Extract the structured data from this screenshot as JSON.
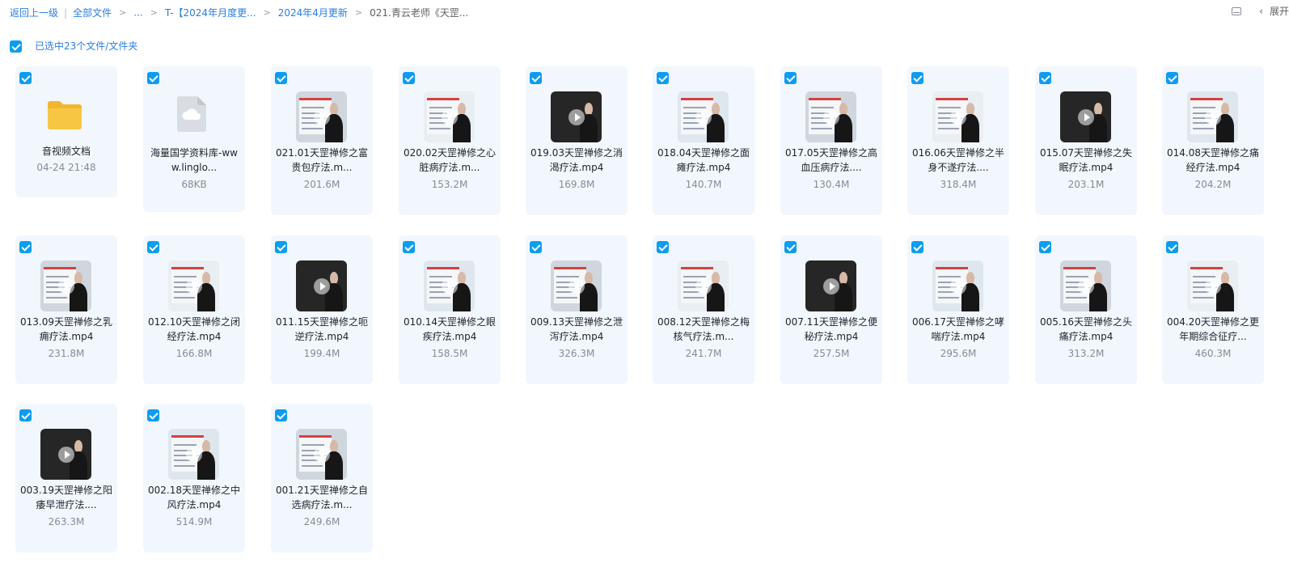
{
  "breadcrumb": {
    "back": "返回上一级",
    "all_files": "全部文件",
    "ellipsis": "...",
    "t_folder": "T-【2024年月度更...",
    "april": "2024年4月更新",
    "current": "021.青云老师《天罡..."
  },
  "toolbar": {
    "expand_label": "展开"
  },
  "selection": {
    "label": "已选中23个文件/文件夹"
  },
  "colors": {
    "accent": "#0d9cf2",
    "link": "#2a7de1",
    "card_bg": "#f1f7fd",
    "folder": "#f7c744"
  },
  "items": [
    {
      "name": "音视频文档",
      "meta": "04-24 21:48",
      "icon": "folder-icon"
    },
    {
      "name": "海量国学资料库-www.linglo...",
      "meta": "68KB",
      "icon": "cloud-file-icon"
    },
    {
      "name": "021.01天罡禅修之富贵包疗法.m...",
      "meta": "201.6M",
      "icon": "video-thumbnail"
    },
    {
      "name": "020.02天罡禅修之心脏病疗法.m...",
      "meta": "153.2M",
      "icon": "video-thumbnail"
    },
    {
      "name": "019.03天罡禅修之消渴疗法.mp4",
      "meta": "169.8M",
      "icon": "video-thumbnail"
    },
    {
      "name": "018.04天罡禅修之面瘫疗法.mp4",
      "meta": "140.7M",
      "icon": "video-thumbnail"
    },
    {
      "name": "017.05天罡禅修之高血压病疗法....",
      "meta": "130.4M",
      "icon": "video-thumbnail"
    },
    {
      "name": "016.06天罡禅修之半身不遂疗法....",
      "meta": "318.4M",
      "icon": "video-thumbnail"
    },
    {
      "name": "015.07天罡禅修之失眠疗法.mp4",
      "meta": "203.1M",
      "icon": "video-thumbnail"
    },
    {
      "name": "014.08天罡禅修之痛经疗法.mp4",
      "meta": "204.2M",
      "icon": "video-thumbnail"
    },
    {
      "name": "013.09天罡禅修之乳痈疗法.mp4",
      "meta": "231.8M",
      "icon": "video-thumbnail"
    },
    {
      "name": "012.10天罡禅修之闭经疗法.mp4",
      "meta": "166.8M",
      "icon": "video-thumbnail"
    },
    {
      "name": "011.15天罡禅修之呃逆疗法.mp4",
      "meta": "199.4M",
      "icon": "video-thumbnail"
    },
    {
      "name": "010.14天罡禅修之眼疾疗法.mp4",
      "meta": "158.5M",
      "icon": "video-thumbnail"
    },
    {
      "name": "009.13天罡禅修之泄泻疗法.mp4",
      "meta": "326.3M",
      "icon": "video-thumbnail"
    },
    {
      "name": "008.12天罡禅修之梅核气疗法.m...",
      "meta": "241.7M",
      "icon": "video-thumbnail"
    },
    {
      "name": "007.11天罡禅修之便秘疗法.mp4",
      "meta": "257.5M",
      "icon": "video-thumbnail"
    },
    {
      "name": "006.17天罡禅修之哮喘疗法.mp4",
      "meta": "295.6M",
      "icon": "video-thumbnail"
    },
    {
      "name": "005.16天罡禅修之头痛疗法.mp4",
      "meta": "313.2M",
      "icon": "video-thumbnail"
    },
    {
      "name": "004.20天罡禅修之更年期综合征疗...",
      "meta": "460.3M",
      "icon": "video-thumbnail"
    },
    {
      "name": "003.19天罡禅修之阳痿早泄疗法....",
      "meta": "263.3M",
      "icon": "video-thumbnail"
    },
    {
      "name": "002.18天罡禅修之中风疗法.mp4",
      "meta": "514.9M",
      "icon": "video-thumbnail"
    },
    {
      "name": "001.21天罡禅修之自选病疗法.m...",
      "meta": "249.6M",
      "icon": "video-thumbnail"
    }
  ]
}
